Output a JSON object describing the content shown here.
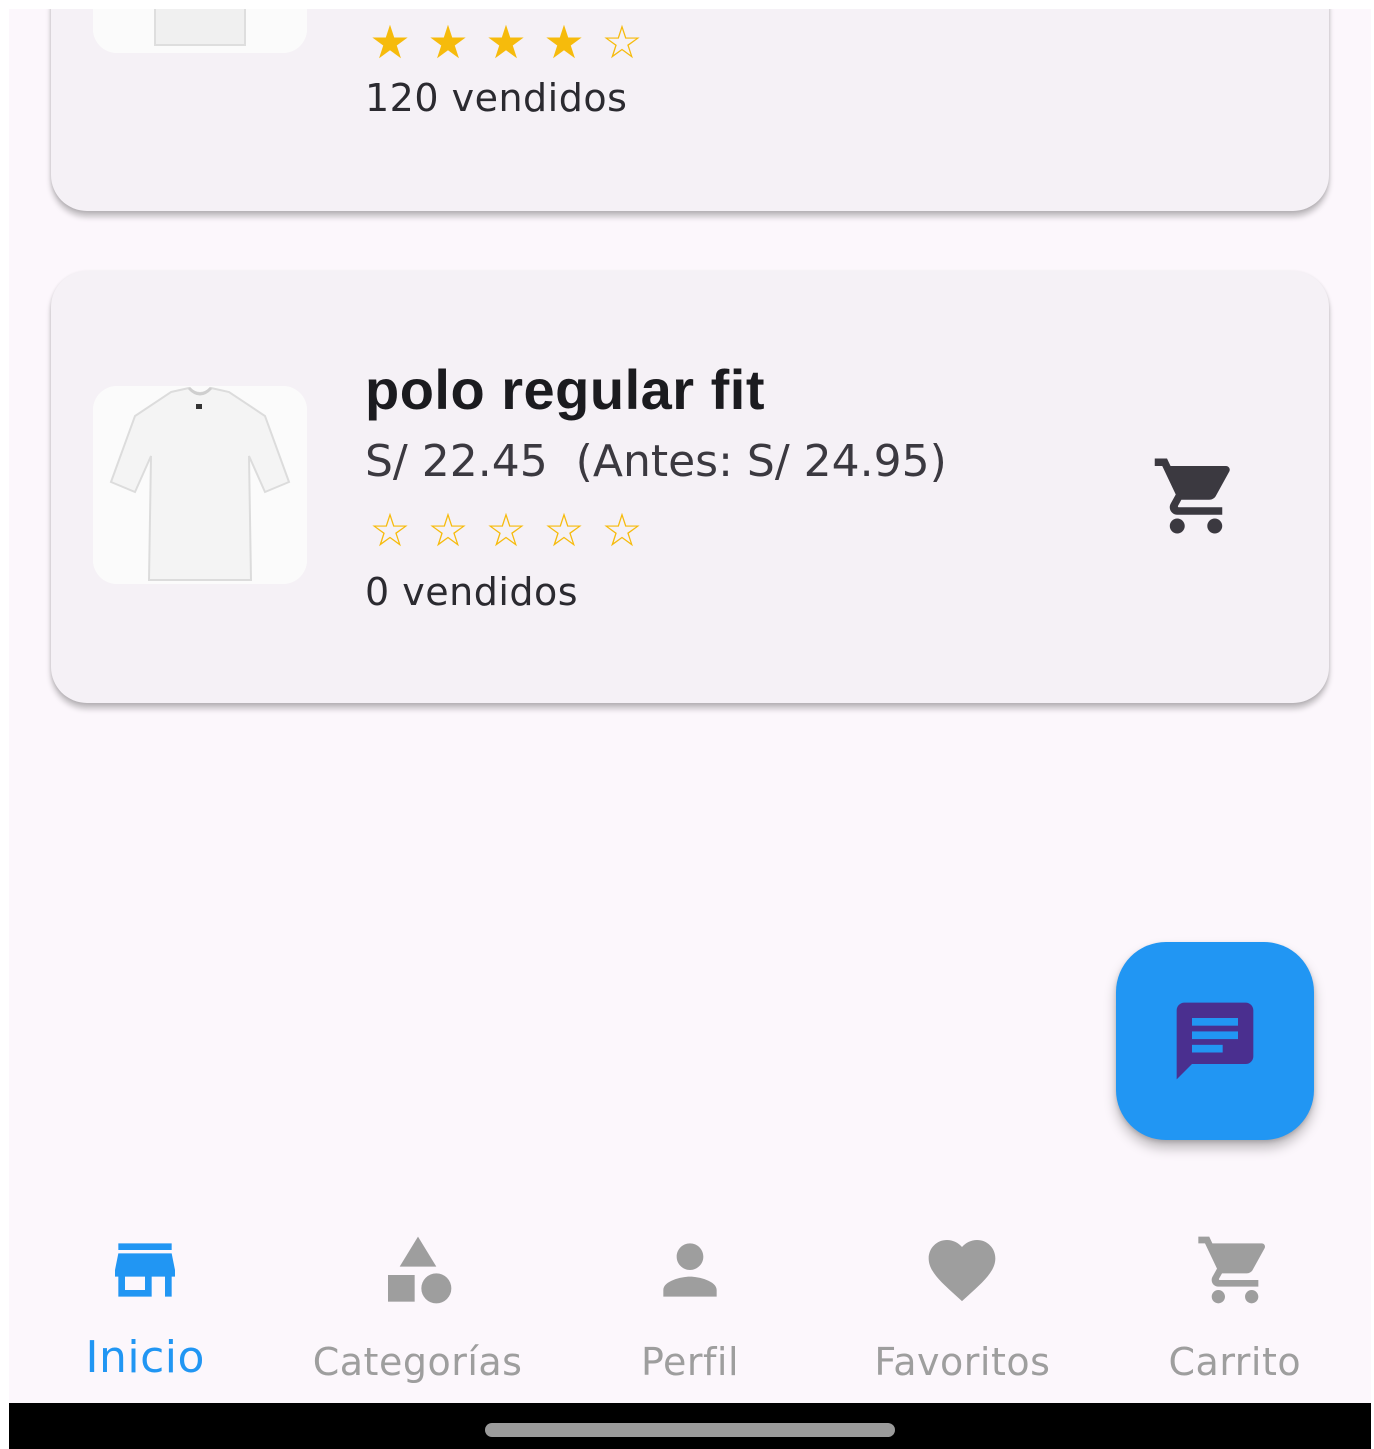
{
  "products": [
    {
      "name": "",
      "price": "",
      "rating": 4,
      "max_rating": 5,
      "sold_label": "120 vendidos"
    },
    {
      "name": "polo regular fit",
      "price": "S/ 22.45  (Antes: S/ 24.95)",
      "rating": 0,
      "max_rating": 5,
      "sold_label": "0 vendidos"
    }
  ],
  "icons": {
    "cart": "shopping-cart-icon",
    "chat": "chat-icon"
  },
  "bottom_nav": {
    "items": [
      {
        "label": "Inicio",
        "icon": "store-icon",
        "active": true
      },
      {
        "label": "Categorías",
        "icon": "category-shapes-icon",
        "active": false
      },
      {
        "label": "Perfil",
        "icon": "person-icon",
        "active": false
      },
      {
        "label": "Favoritos",
        "icon": "heart-icon",
        "active": false
      },
      {
        "label": "Carrito",
        "icon": "shopping-cart-icon",
        "active": false
      }
    ]
  },
  "colors": {
    "accent": "#2196f3",
    "star": "#f6bb0c",
    "inactive": "#9e9e9e",
    "chat_icon": "#4a2f8f"
  }
}
